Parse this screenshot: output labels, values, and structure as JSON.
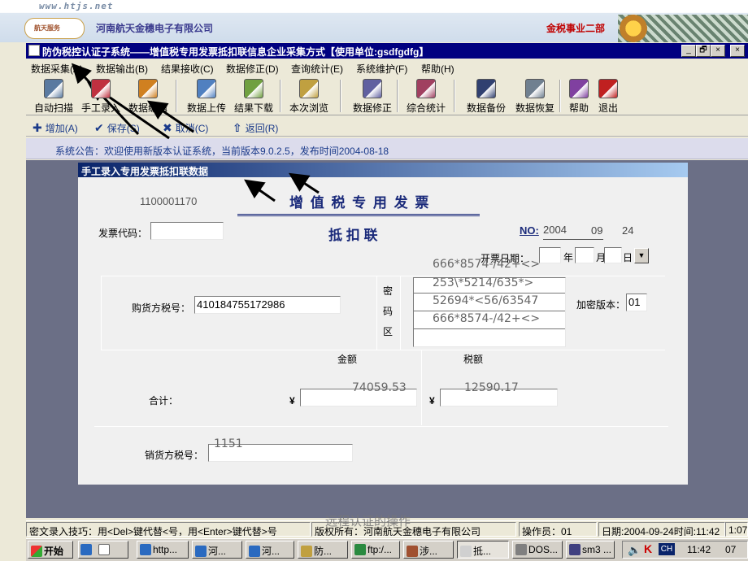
{
  "banner": {
    "site_url": "www.htjs.net",
    "logo_text": "航天服务",
    "company": "河南航天金穗电子有限公司",
    "division": "金税事业二部"
  },
  "window": {
    "title": "防伪税控认证子系统——增值税专用发票抵扣联信息企业采集方式【使用单位:gsdfgdfg】",
    "controls": [
      "_",
      "🗗",
      "×",
      "×"
    ]
  },
  "menu": [
    "数据采集(A)",
    "数据输出(B)",
    "结果接收(C)",
    "数据修正(D)",
    "查询统计(E)",
    "系统维护(F)",
    "帮助(H)"
  ],
  "toolbar": [
    {
      "label": "自动扫描",
      "icon": "scanner-icon",
      "color": "#5a7aa0"
    },
    {
      "label": "手工录入",
      "icon": "manual-entry-icon",
      "color": "#c03040"
    },
    {
      "label": "数据编辑",
      "icon": "edit-data-icon",
      "color": "#d08020"
    },
    {
      "label": "数据上传",
      "icon": "upload-icon",
      "color": "#5080c0"
    },
    {
      "label": "结果下载",
      "icon": "download-icon",
      "color": "#70a040"
    },
    {
      "label": "本次浏览",
      "icon": "browse-icon",
      "color": "#c0a040"
    },
    {
      "label": "数据修正",
      "icon": "correct-data-icon",
      "color": "#6060a0"
    },
    {
      "label": "综合统计",
      "icon": "statistics-icon",
      "color": "#a04060"
    },
    {
      "label": "数据备份",
      "icon": "backup-icon",
      "color": "#304070"
    },
    {
      "label": "数据恢复",
      "icon": "restore-icon",
      "color": "#708090"
    },
    {
      "label": "帮助",
      "icon": "help-icon",
      "color": "#8040a0"
    },
    {
      "label": "退出",
      "icon": "exit-icon",
      "color": "#c02020"
    }
  ],
  "toolbar2": [
    {
      "label": "增加(A)",
      "glyph": "✚"
    },
    {
      "label": "保存(S)",
      "glyph": "✔"
    },
    {
      "label": "取消(C)",
      "glyph": "✖"
    },
    {
      "label": "返回(R)",
      "glyph": "⇧"
    }
  ],
  "notice": "系统公告：欢迎使用新版本认证系统，当前版本9.0.2.5，发布时间2004-08-18",
  "form": {
    "title": "手工录入专用发票抵扣联数据",
    "invoice_heading": "增 值 税 专 用 发 票",
    "invoice_subheading": "抵  扣  联",
    "code_left": "1100001170",
    "invoice_code_label": "发票代码：",
    "invoice_code_value": "",
    "no_label": "NO:",
    "no_value": "2004",
    "no_extra_1": "09",
    "no_extra_2": "24",
    "date_label": "开票日期：",
    "date_year_unit": "年",
    "date_month_unit": "月",
    "date_day_unit": "日",
    "buyer_tax_label": "购货方税号：",
    "buyer_tax_value": "410184755172986",
    "cipher_label_1": "密",
    "cipher_label_2": "码",
    "cipher_label_3": "区",
    "cipher_lines": [
      "666*8574-/42+<>",
      "253\\*5214/635*>",
      "52694*<56/63547",
      "666*8574-/42+<>"
    ],
    "encrypt_version_label": "加密版本：",
    "encrypt_version_value": "01",
    "amount_header": "金额",
    "tax_header": "税额",
    "total_label": "合计：",
    "currency_1": "¥",
    "currency_2": "¥",
    "total_amount": "74059.53",
    "total_tax": "12590.17",
    "seller_tax_label": "销货方税号：",
    "seller_tax_value": "1151"
  },
  "status": {
    "tip": "密文录入技巧：用<Del>键代替<号，用<Enter>键代替>号",
    "copyright": "版权所有：河南航天金穗电子有限公司",
    "operator": "操作员：01",
    "datetime": "日期:2004-09-24时间:11:42",
    "extra": "1:07"
  },
  "caption": "远程认证的操作",
  "taskbar": {
    "start": "开始",
    "tasks": [
      "http...",
      "河...",
      "河...",
      "防...",
      "ftp:/...",
      "涉...",
      "抵...",
      "DOS...",
      "sm3 ..."
    ],
    "clock": "11:42",
    "ime": "CH",
    "extra": "07"
  }
}
